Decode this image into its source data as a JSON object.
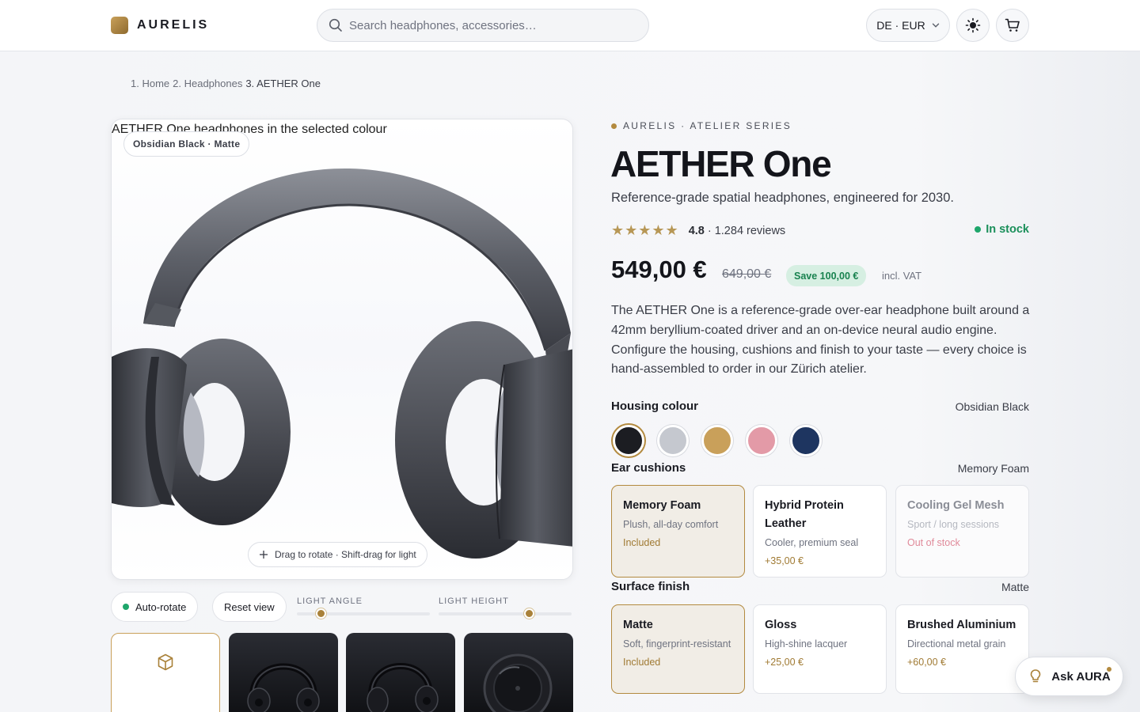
{
  "brand": {
    "name": "AURELIS"
  },
  "search": {
    "placeholder": "Search headphones, accessories…"
  },
  "locale": {
    "label": "DE · EUR"
  },
  "breadcrumb": {
    "items": [
      "1. Home",
      "2. Headphones",
      "3. AETHER One"
    ]
  },
  "viewer": {
    "alt_text": "AETHER One headphones in the selected colour",
    "finish_badge": "Obsidian Black · Matte",
    "hint": "Drag to rotate · Shift-drag for light"
  },
  "controls": {
    "auto_rotate": "Auto-rotate",
    "reset_view": "Reset view",
    "light_angle": {
      "label": "LIGHT ANGLE",
      "value_fraction": 0.18
    },
    "light_height": {
      "label": "LIGHT HEIGHT",
      "value_fraction": 0.68
    }
  },
  "product": {
    "series": "AURELIS · ATELIER SERIES",
    "title": "AETHER One",
    "subtitle": "Reference-grade spatial headphones, engineered for 2030.",
    "stars": "★★★★★",
    "rating": "4.8",
    "reviews": "· 1.284 reviews",
    "stock": "In stock",
    "price": "549,00 €",
    "old_price": "649,00 €",
    "save": "Save 100,00 €",
    "vat": "incl. VAT",
    "description": "The AETHER One is a reference-grade over-ear headphone built around a 42mm beryllium-coated driver and an on-device neural audio engine. Configure the housing, cushions and finish to your taste — every choice is hand-assembled to order in our Zürich atelier."
  },
  "housing": {
    "title": "Housing colour",
    "value": "Obsidian Black",
    "swatches": [
      "#1c1d22",
      "#c5c8cf",
      "#c9a05a",
      "#e39aa7",
      "#1e3560"
    ],
    "selected": 0
  },
  "cushions": {
    "title": "Ear cushions",
    "value": "Memory Foam",
    "options": [
      {
        "name": "Memory Foam",
        "desc": "Plush, all-day comfort",
        "price": "Included"
      },
      {
        "name": "Hybrid Protein Leather",
        "desc": "Cooler, premium seal",
        "price": "+35,00 €"
      },
      {
        "name": "Cooling Gel Mesh",
        "desc": "Sport / long sessions",
        "price": "Out of stock"
      }
    ]
  },
  "finish": {
    "title": "Surface finish",
    "value": "Matte",
    "options": [
      {
        "name": "Matte",
        "desc": "Soft, fingerprint-resistant",
        "price": "Included"
      },
      {
        "name": "Gloss",
        "desc": "High-shine lacquer",
        "price": "+25,00 €"
      },
      {
        "name": "Brushed Aluminium",
        "desc": "Directional metal grain",
        "price": "+60,00 €"
      }
    ]
  },
  "assistant": {
    "label": "Ask AURA"
  },
  "colors": {
    "accent": "#b38a3f",
    "success": "#1a8f5a"
  }
}
